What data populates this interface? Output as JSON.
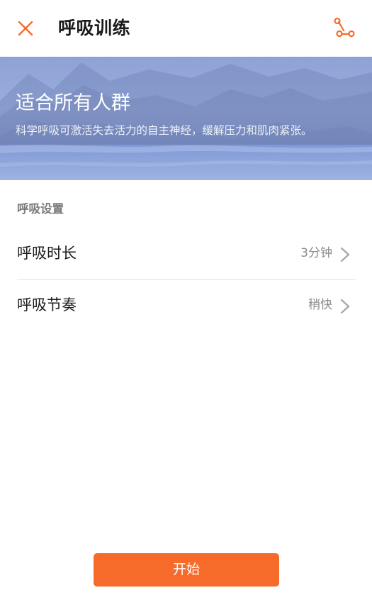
{
  "header": {
    "title": "呼吸训练",
    "close_icon": "close-icon",
    "share_icon": "share-icon",
    "accent_color": "#f76b2a"
  },
  "banner": {
    "title": "适合所有人群",
    "subtitle": "科学呼吸可激活失去活力的自主神经，缓解压力和肌肉紧张。",
    "background_color": "#8fa3d8"
  },
  "settings": {
    "section_label": "呼吸设置",
    "rows": [
      {
        "label": "呼吸时长",
        "value": "3分钟",
        "icon": "chevron-right-icon"
      },
      {
        "label": "呼吸节奏",
        "value": "稍快",
        "icon": "chevron-right-icon"
      }
    ]
  },
  "footer": {
    "start_label": "开始",
    "button_color": "#f76b2a"
  }
}
